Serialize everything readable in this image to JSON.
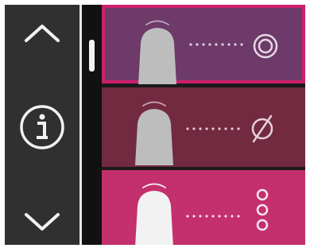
{
  "navigation": {
    "up_icon": "chevron-up-icon",
    "info_icon": "info-icon",
    "down_icon": "chevron-down-icon"
  },
  "scrollbar": {
    "position": 0.0
  },
  "list": {
    "items": [
      {
        "id": "concentric-circles",
        "icon": "concentric-circles-icon",
        "selected": true,
        "color": "#6d3a6a"
      },
      {
        "id": "empty-set",
        "icon": "empty-set-icon",
        "selected": false,
        "color": "#722a40"
      },
      {
        "id": "three-circles",
        "icon": "three-stacked-circles-icon",
        "selected": false,
        "color": "#c42f6d"
      }
    ]
  },
  "colors": {
    "selected_border": "#cc1f6b",
    "nav_bg": "#303030",
    "icon_color": "#f2f2f2"
  }
}
